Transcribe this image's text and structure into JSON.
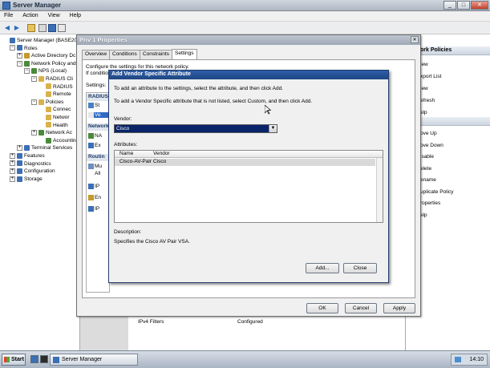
{
  "window": {
    "title": "Server Manager"
  },
  "menu": [
    "File",
    "Action",
    "View",
    "Help"
  ],
  "tree": [
    {
      "label": "Server Manager (BASE2008",
      "indent": 0,
      "expander": "",
      "color": "#3b6fb6"
    },
    {
      "label": "Roles",
      "indent": 1,
      "expander": "-",
      "color": "#3b6fb6"
    },
    {
      "label": "Active Directory Dc",
      "indent": 2,
      "expander": "+",
      "color": "#c49a2a"
    },
    {
      "label": "Network Policy and",
      "indent": 2,
      "expander": "-",
      "color": "#4a8a3a"
    },
    {
      "label": "NPS (Local)",
      "indent": 3,
      "expander": "-",
      "color": "#4a8a3a"
    },
    {
      "label": "RADIUS Cli",
      "indent": 4,
      "expander": "-",
      "color": "#d8b24a"
    },
    {
      "label": "RADIUS",
      "indent": 5,
      "expander": "",
      "color": "#d8b24a"
    },
    {
      "label": "Remote",
      "indent": 5,
      "expander": "",
      "color": "#d8b24a"
    },
    {
      "label": "Policies",
      "indent": 4,
      "expander": "-",
      "color": "#d8b24a"
    },
    {
      "label": "Connec",
      "indent": 5,
      "expander": "",
      "color": "#d8b24a"
    },
    {
      "label": "Networ",
      "indent": 5,
      "expander": "",
      "color": "#d8b24a"
    },
    {
      "label": "Health",
      "indent": 5,
      "expander": "",
      "color": "#d8b24a"
    },
    {
      "label": "Network Ac",
      "indent": 4,
      "expander": "+",
      "color": "#4a8a3a"
    },
    {
      "label": "Accounting",
      "indent": 5,
      "expander": "",
      "color": "#4a8a3a"
    },
    {
      "label": "Terminal Services",
      "indent": 2,
      "expander": "+",
      "color": "#3b6fb6"
    },
    {
      "label": "Features",
      "indent": 1,
      "expander": "+",
      "color": "#3b6fb6"
    },
    {
      "label": "Diagnostics",
      "indent": 1,
      "expander": "+",
      "color": "#3b6fb6"
    },
    {
      "label": "Configuration",
      "indent": 1,
      "expander": "+",
      "color": "#3b6fb6"
    },
    {
      "label": "Storage",
      "indent": 1,
      "expander": "+",
      "color": "#3b6fb6"
    }
  ],
  "actions": {
    "heading_top": "ork Policies",
    "items_top": [
      "iew",
      "xport List",
      "iew",
      "efresh",
      "elp"
    ],
    "items_bottom": [
      "ove Up",
      "ove Down",
      "isable",
      "elete",
      "ename",
      "uplicate Policy",
      "roperties",
      "elp"
    ]
  },
  "background_list": {
    "row_name": "IPv4 Filters",
    "row_value": "Configured"
  },
  "policy_dialog": {
    "title": "Priv 1 Properties",
    "tabs": [
      "Overview",
      "Conditions",
      "Constraints",
      "Settings"
    ],
    "active_tab": "Settings",
    "intro_1": "Configure the settings for this network policy.",
    "intro_2": "If conditio",
    "settings_label": "Settings:",
    "nav": {
      "head_radius": "RADIUS",
      "item_st": "St",
      "item_ve": "Ve",
      "head_network": "Network",
      "item_na": "NA",
      "item_ex": "Ex",
      "head_routing": "Routin",
      "item_mu": "Mu",
      "item_all": "All",
      "item_ip": "IP",
      "item_en": "En",
      "item_ip2": "IP"
    },
    "ok": "OK",
    "cancel": "Cancel",
    "apply": "Apply"
  },
  "vsa_dialog": {
    "title": "Add Vendor Specific Attribute",
    "instruction_1": "To add an attribute to the settings, select the attribute, and then click Add.",
    "instruction_2": "To add a Vendor Specific attribute that is not listed, select Custom, and then click Add.",
    "vendor_label": "Vendor:",
    "vendor_value": "Cisco",
    "attributes_label": "Attributes:",
    "columns": [
      "Name",
      "Vendor"
    ],
    "rows": [
      {
        "name": "Cisco-AV-Pair",
        "vendor": "Cisco"
      }
    ],
    "description_label": "Description:",
    "description_text": "Specifies the Cisco AV Pair VSA.",
    "add": "Add...",
    "close": "Close"
  },
  "taskbar": {
    "start": "Start",
    "app": "Server Manager",
    "time": "14:10"
  },
  "colors": {
    "selection": "#0a246a",
    "title_active": "#1e4683"
  }
}
